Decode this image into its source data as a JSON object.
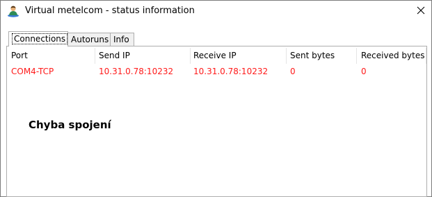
{
  "window": {
    "title": "Virtual metelcom - status information",
    "close_icon": "close-icon",
    "app_icon": "user-person-icon"
  },
  "tabs": [
    {
      "label": "Connections",
      "active": true
    },
    {
      "label": "Autoruns",
      "active": false
    },
    {
      "label": "Info",
      "active": false
    }
  ],
  "table": {
    "columns": [
      "Port",
      "Send IP",
      "Receive IP",
      "Sent bytes",
      "Received bytes"
    ],
    "rows": [
      {
        "port": "COM4-TCP",
        "send_ip": "10.31.0.78:10232",
        "receive_ip": "10.31.0.78:10232",
        "sent_bytes": "0",
        "received_bytes": "0"
      }
    ],
    "row_color": "#ff1a1a"
  },
  "message": "Chyba spojení"
}
